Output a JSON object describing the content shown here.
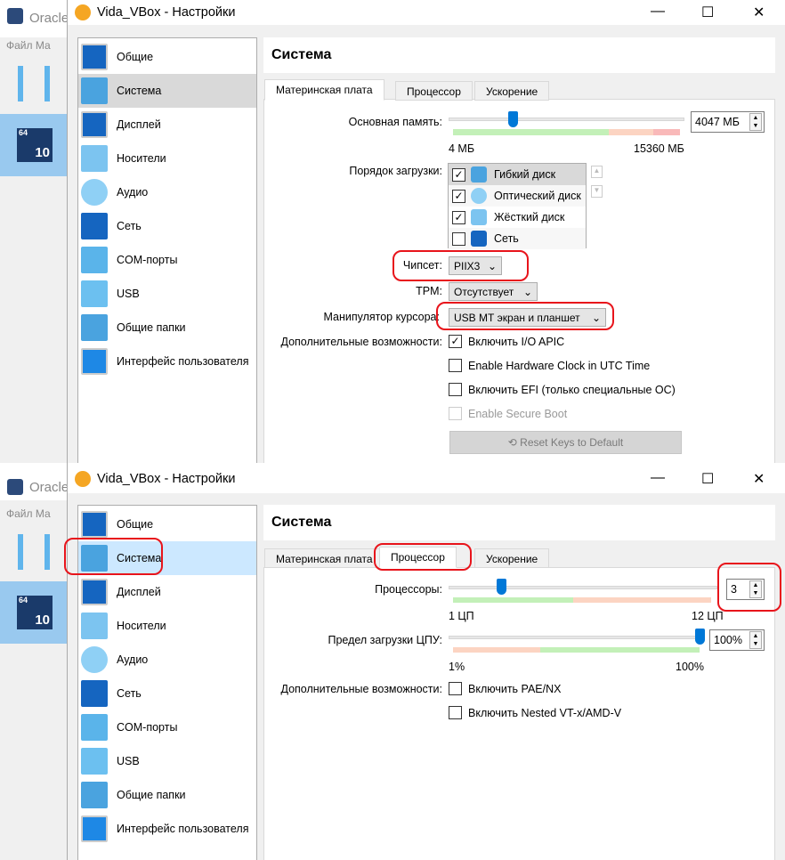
{
  "background_app": {
    "title": "Oracle",
    "menu": "Файл  Ма",
    "vm_badge": "64",
    "vm_version": "10"
  },
  "dialog": {
    "title": "Vida_VBox - Настройки",
    "minimize": "—",
    "maximize": "☐",
    "close": "✕"
  },
  "sidebar": {
    "items": [
      {
        "label": "Общие",
        "icon": "general-icon"
      },
      {
        "label": "Система",
        "icon": "system-chip-icon"
      },
      {
        "label": "Дисплей",
        "icon": "display-icon"
      },
      {
        "label": "Носители",
        "icon": "storage-icon"
      },
      {
        "label": "Аудио",
        "icon": "audio-icon"
      },
      {
        "label": "Сеть",
        "icon": "network-icon"
      },
      {
        "label": "COM-порты",
        "icon": "serial-port-icon"
      },
      {
        "label": "USB",
        "icon": "usb-icon"
      },
      {
        "label": "Общие папки",
        "icon": "shared-folder-icon"
      },
      {
        "label": "Интерфейс пользователя",
        "icon": "user-interface-icon"
      }
    ]
  },
  "page_title": "Система",
  "tabs": [
    "Материнская плата",
    "Процессор",
    "Ускорение"
  ],
  "motherboard": {
    "memory_label": "Основная память:",
    "memory_value": "4047 МБ",
    "memory_min": "4 МБ",
    "memory_max": "15360 МБ",
    "memory_fraction": 0.263,
    "boot_label": "Порядок загрузки:",
    "boot_items": [
      {
        "label": "Гибкий диск",
        "checked": "✓"
      },
      {
        "label": "Оптический диск",
        "checked": "✓"
      },
      {
        "label": "Жёсткий диск",
        "checked": "✓"
      },
      {
        "label": "Сеть",
        "checked": ""
      }
    ],
    "chipset_label": "Чипсет:",
    "chipset_value": "PIIX3",
    "tpm_label": "TPM:",
    "tpm_value": "Отсутствует",
    "pointer_label": "Манипулятор курсора:",
    "pointer_value": "USB МТ экран и планшет",
    "extended_label": "Дополнительные возможности:",
    "options": [
      {
        "label": "Включить I/O APIC",
        "checked": "✓"
      },
      {
        "label": "Enable Hardware Clock in UTC Time",
        "checked": ""
      },
      {
        "label": "Включить EFI (только специальные ОС)",
        "checked": ""
      },
      {
        "label": "Enable Secure Boot",
        "checked": "",
        "disabled": true
      }
    ],
    "reset_button": "Reset Keys to Default"
  },
  "processor": {
    "cpu_label": "Процессоры:",
    "cpu_value": "3",
    "cpu_min": "1 ЦП",
    "cpu_max": "12 ЦП",
    "cap_label": "Предел загрузки ЦПУ:",
    "cap_value": "100%",
    "cap_min": "1%",
    "cap_max": "100%",
    "extended_label": "Дополнительные возможности:",
    "options": [
      {
        "label": "Включить PAE/NX",
        "checked": ""
      },
      {
        "label": "Включить Nested VT-x/AMD-V",
        "checked": ""
      }
    ]
  },
  "colors": {
    "accent": "#0078d7",
    "annotation": "#e8141b",
    "selected_grey": "#d9d9d9",
    "selected_blue": "#cce8ff"
  }
}
